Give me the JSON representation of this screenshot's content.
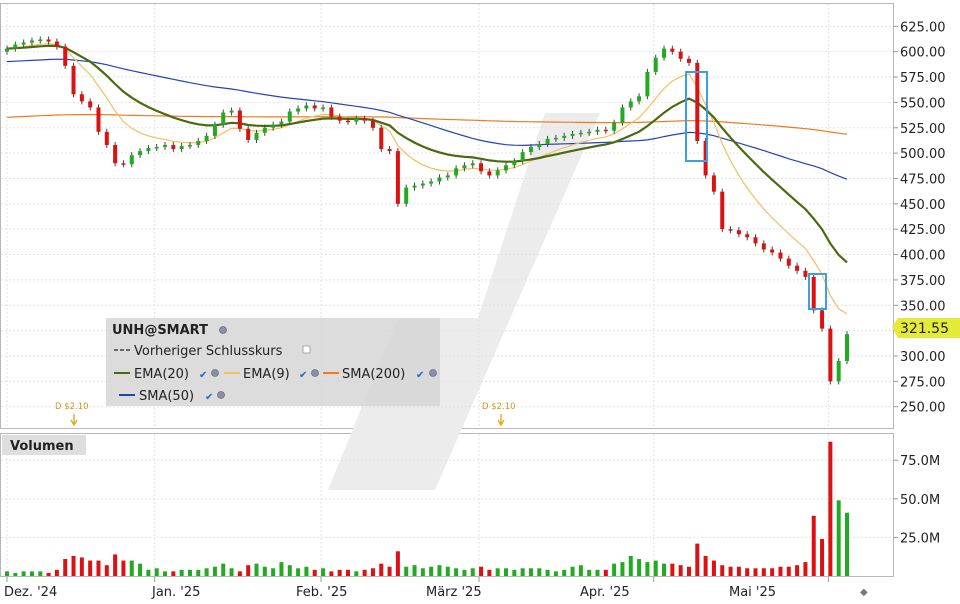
{
  "ticker_legend": {
    "symbol": "UNH@SMART",
    "prev_close_label": "Vorheriger Schlusskurs",
    "indicators": [
      "EMA(20)",
      "EMA(9)",
      "SMA(200)",
      "SMA(50)"
    ]
  },
  "last_price_label": "321.55",
  "dividends": [
    "D $2.10",
    "D $2.10"
  ],
  "volume_panel": {
    "title": "Volumen"
  },
  "colors": {
    "up": "#22aa22",
    "down": "#dd1111",
    "ema20": "#4a6a10",
    "ema9": "#f2c060",
    "sma200": "#ee7a22",
    "sma50": "#2244bb",
    "highlight": "#3aa0e0",
    "price_tag": "#e4ea3a",
    "volume_neutral": "#888888"
  },
  "chart_data": [
    {
      "type": "candlestick",
      "title": "",
      "x_tick_labels": [
        "Dez. '24",
        "Jan. '25",
        "Feb. '25",
        "März '25",
        "Apr. '25",
        "Mai '25"
      ],
      "y_tick_labels": [
        "625.00",
        "600.00",
        "575.00",
        "550.00",
        "525.00",
        "500.00",
        "475.00",
        "450.00",
        "425.00",
        "400.00",
        "375.00",
        "350.00",
        "325.00",
        "300.00",
        "275.00",
        "250.00"
      ],
      "ylim": [
        229,
        647
      ],
      "grid": true,
      "legend_placement": "middle-left",
      "close": [
        603,
        607,
        609,
        611,
        612,
        610,
        605,
        586,
        558,
        551,
        545,
        521,
        508,
        490,
        489,
        498,
        502,
        505,
        506,
        508,
        504,
        507,
        508,
        512,
        517,
        528,
        540,
        542,
        524,
        513,
        520,
        525,
        528,
        531,
        541,
        544,
        547,
        544,
        545,
        536,
        532,
        531,
        534,
        532,
        525,
        504,
        502,
        450,
        466,
        468,
        470,
        472,
        476,
        478,
        485,
        488,
        490,
        482,
        478,
        483,
        488,
        492,
        501,
        506,
        509,
        514,
        515,
        517,
        519,
        520,
        521,
        523,
        522,
        530,
        545,
        551,
        556,
        580,
        594,
        603,
        600,
        593,
        589,
        512,
        478,
        462,
        425,
        424,
        420,
        417,
        411,
        405,
        402,
        396,
        389,
        384,
        378,
        345,
        327,
        275,
        295,
        321.55
      ],
      "volume": [
        3,
        2,
        3,
        3,
        3,
        2,
        4,
        11,
        13,
        12,
        10,
        10,
        7,
        14,
        10,
        10,
        8,
        4,
        5,
        3,
        3,
        4,
        4,
        4,
        5,
        6,
        8,
        5,
        3,
        7,
        8,
        6,
        5,
        9,
        7,
        5,
        6,
        4,
        5,
        3,
        4,
        4,
        3,
        4,
        5,
        8,
        6,
        16,
        6,
        7,
        5,
        6,
        7,
        6,
        5,
        4,
        5,
        6,
        4,
        5,
        5,
        4,
        5,
        5,
        5,
        4,
        3,
        4,
        6,
        7,
        4,
        4,
        4,
        8,
        9,
        13,
        11,
        9,
        10,
        8,
        8,
        7,
        6,
        21,
        13,
        10,
        7,
        6,
        6,
        5,
        5,
        5,
        5,
        6,
        6,
        7,
        9,
        39,
        24,
        87,
        49,
        41
      ],
      "volume_unit": "M"
    },
    {
      "type": "bar",
      "title": "Volumen",
      "y_tick_labels": [
        "75.0M",
        "50.0M",
        "25.0M"
      ],
      "ylim": [
        0,
        92
      ]
    }
  ]
}
